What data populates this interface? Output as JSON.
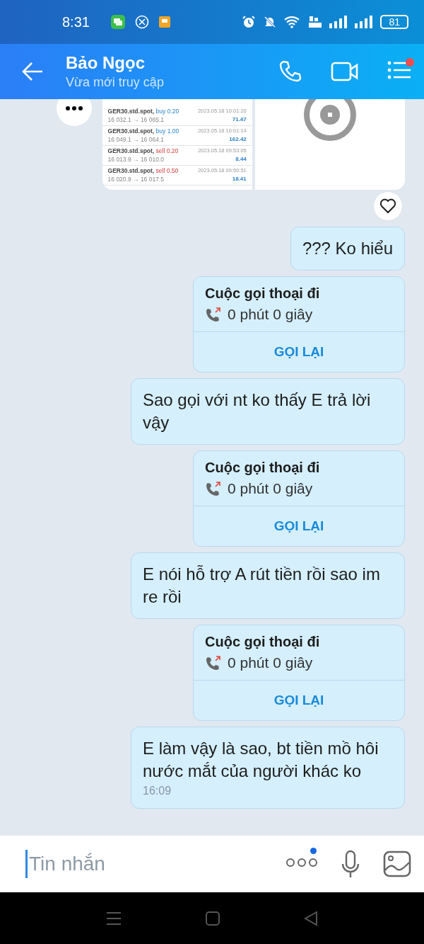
{
  "status_bar": {
    "time": "8:31",
    "battery": "81"
  },
  "header": {
    "name": "Bảo Ngọc",
    "status": "Vừa mới truy cập",
    "menu_badge": true
  },
  "messages": [
    {
      "kind": "image_pair",
      "trades": [
        {
          "symbol": "GER30.std.spot,",
          "side": "buy",
          "order": "0.20",
          "date": "2023.05.18 10:01:20",
          "prices": "16 032.1 → 16 065.1",
          "profit": "71.47"
        },
        {
          "symbol": "GER30.std.spot,",
          "side": "buy",
          "order": "1.00",
          "date": "2023.05.18 10:01:14",
          "prices": "16 049.1 → 16 064.1",
          "profit": "162.42"
        },
        {
          "symbol": "GER30.std.spot,",
          "side": "sell",
          "order": "0.20",
          "date": "2023.05.18 09:53:05",
          "prices": "16 013.9 → 16 010.0",
          "profit": "8.44"
        },
        {
          "symbol": "GER30.std.spot,",
          "side": "sell",
          "order": "0.50",
          "date": "2023.05.18 09:50:51",
          "prices": "16 020.9 → 16 017.5",
          "profit": "18.41"
        }
      ]
    },
    {
      "kind": "text",
      "text": "??? Ko hiểu"
    },
    {
      "kind": "call",
      "title": "Cuộc gọi thoại đi",
      "duration": "0 phút 0 giây",
      "action": "GỌI LẠI"
    },
    {
      "kind": "text",
      "text": "Sao gọi với nt ko thấy E trả lời vậy"
    },
    {
      "kind": "call",
      "title": "Cuộc gọi thoại đi",
      "duration": "0 phút 0 giây",
      "action": "GỌI LẠI"
    },
    {
      "kind": "text",
      "text": "E nói hỗ trợ A rút tiền rồi sao im re rồi"
    },
    {
      "kind": "call",
      "title": "Cuộc gọi thoại đi",
      "duration": "0 phút 0 giây",
      "action": "GỌI LẠI"
    },
    {
      "kind": "text",
      "text": "E làm vậy là sao, bt tiền mồ hôi nước mắt của người khác ko",
      "time": "16:09"
    }
  ],
  "composer": {
    "placeholder": "Tin nhắn",
    "more_badge": true
  }
}
